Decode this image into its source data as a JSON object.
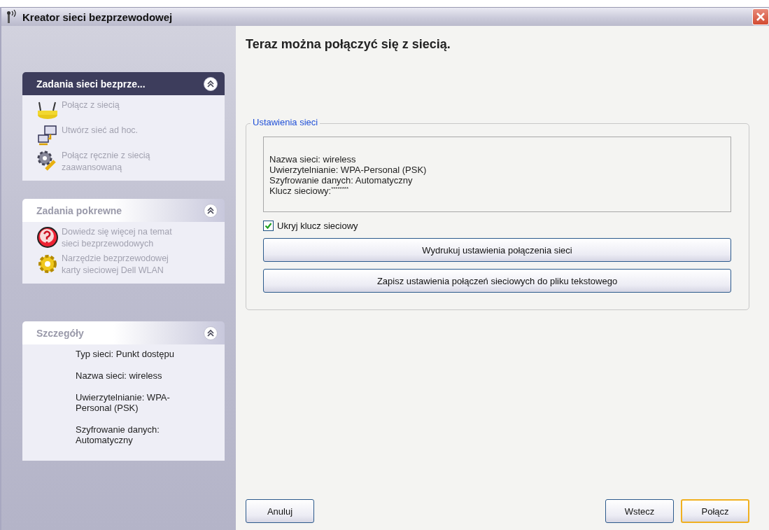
{
  "window": {
    "title": "Kreator sieci bezprzewodowej"
  },
  "sidebar": {
    "panels": [
      {
        "kind": "tasks",
        "title": "Zadania sieci bezprze...",
        "active": true,
        "expanded": true,
        "items": [
          {
            "label": "Połącz z siecią",
            "disabled": true
          },
          {
            "label": "Utwórz sieć ad hoc.",
            "disabled": true
          },
          {
            "label": "Połącz ręcznie z siecią zaawansowaną",
            "disabled": true
          }
        ]
      },
      {
        "kind": "tasks",
        "title": "Zadania pokrewne",
        "active": false,
        "expanded": true,
        "items": [
          {
            "label": "Dowiedz się więcej na temat sieci bezprzewodowych",
            "disabled": true
          },
          {
            "label": "Narzędzie bezprzewodowej karty sieciowej Dell WLAN",
            "disabled": true
          }
        ]
      },
      {
        "kind": "details",
        "title": "Szczegóły",
        "active": false,
        "expanded": true,
        "lines": [
          "Typ sieci: Punkt dostępu",
          "Nazwa sieci: wireless",
          "Uwierzytelnianie: WPA-Personal (PSK)",
          "Szyfrowanie danych: Automatyczny"
        ]
      }
    ]
  },
  "content": {
    "heading": "Teraz można połączyć się z siecią.",
    "group": {
      "legend": "Ustawienia sieci",
      "summary": [
        "Nazwa sieci: wireless",
        "Uwierzytelnianie: WPA-Personal (PSK)",
        "Szyfrowanie danych: Automatyczny"
      ],
      "key_label": "Klucz sieciowy:",
      "key_mask": "********",
      "checkbox": {
        "label": "Ukryj klucz sieciowy",
        "checked": true
      },
      "actions": [
        "Wydrukuj ustawienia połączenia sieci",
        "Zapisz ustawienia połączeń sieciowych do pliku tekstowego"
      ]
    }
  },
  "footer": {
    "left_buttons": [
      {
        "label": "Anuluj",
        "default": false
      }
    ],
    "right_buttons": [
      {
        "label": "Wstecz",
        "default": false
      },
      {
        "label": "Połącz",
        "default": true
      }
    ]
  }
}
